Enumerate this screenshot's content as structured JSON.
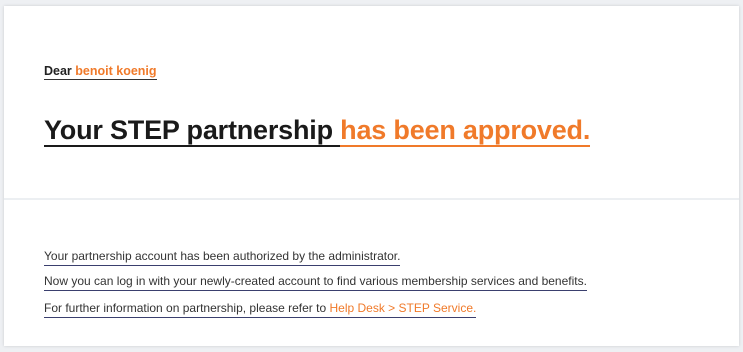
{
  "greeting": {
    "prefix": "Dear ",
    "name": "benoit koenig"
  },
  "headline": {
    "part1": "Your STEP partnership ",
    "part2": "has been approved."
  },
  "body": {
    "line1": "Your partnership account has been authorized by the administrator.",
    "line2": "Now you can log in with your newly-created account to find various membership services and benefits.",
    "line3_prefix": "For further information on partnership, please refer to ",
    "line3_link": "Help Desk > STEP Service."
  },
  "colors": {
    "accent": "#f07a2a",
    "text": "#1a1a1a",
    "underline": "#3a3f6e"
  }
}
